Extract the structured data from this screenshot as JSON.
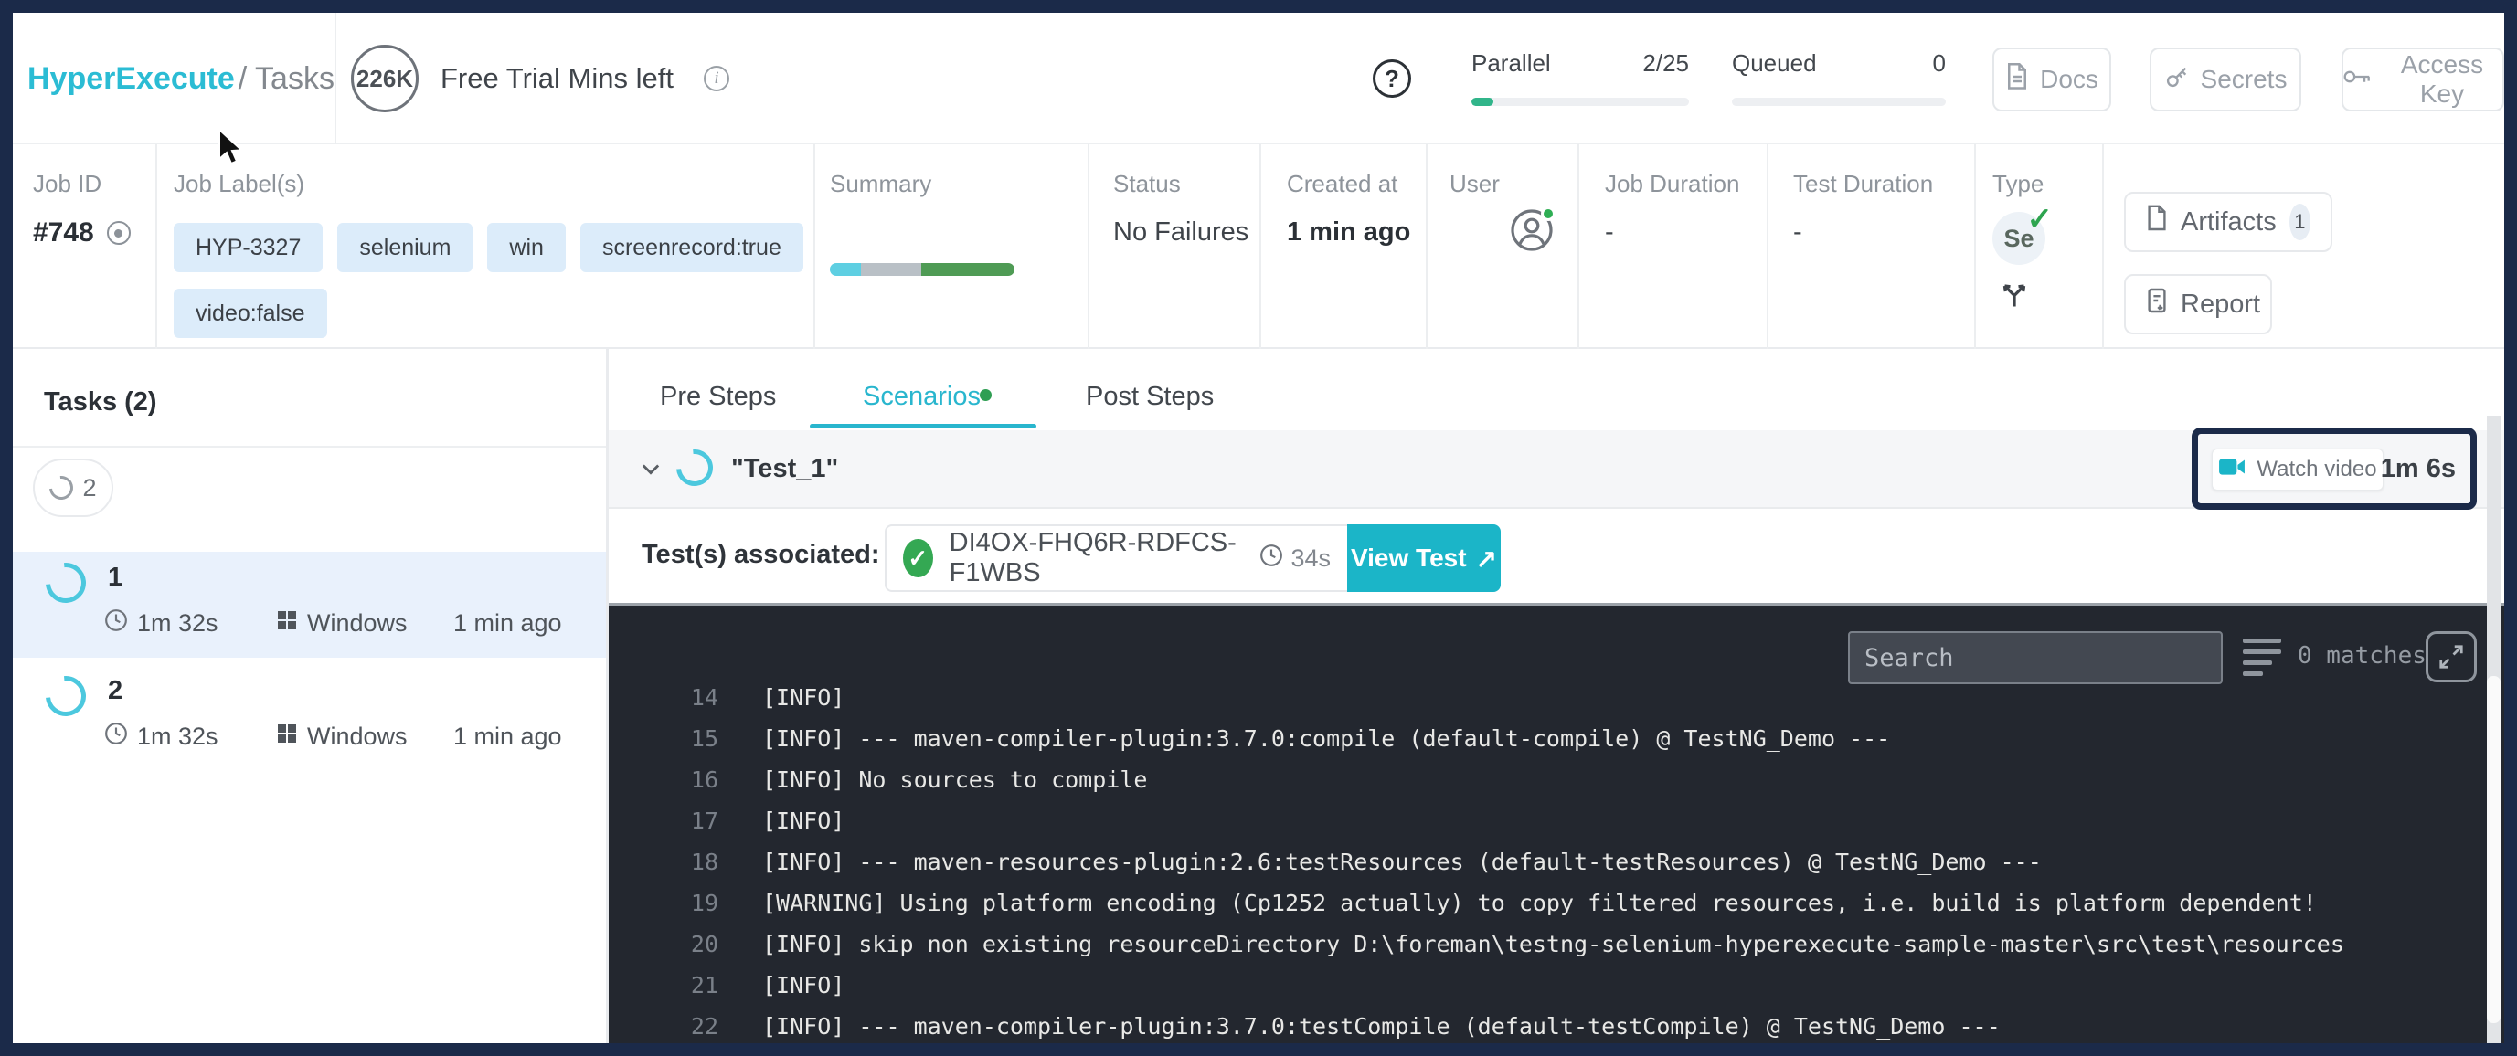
{
  "header": {
    "breadcrumb": {
      "brand": "HyperExecute",
      "rest": "/ Tasks"
    },
    "trial": {
      "badge": "226K",
      "label": "Free Trial Mins left"
    },
    "help": "?",
    "parallel": {
      "label": "Parallel",
      "value": "2/25"
    },
    "queued": {
      "label": "Queued",
      "value": "0"
    },
    "buttons": {
      "docs": "Docs",
      "secrets": "Secrets",
      "access_key": "Access Key"
    }
  },
  "job": {
    "job_id": {
      "label": "Job ID",
      "value": "#748"
    },
    "labels": {
      "label": "Job Label(s)",
      "chips": [
        "HYP-3327",
        "selenium",
        "win",
        "screenrecord:true",
        "video:false"
      ]
    },
    "summary": {
      "label": "Summary"
    },
    "status": {
      "label": "Status",
      "value": "No Failures"
    },
    "created": {
      "label": "Created at",
      "value": "1 min ago"
    },
    "user": {
      "label": "User"
    },
    "job_duration": {
      "label": "Job Duration",
      "value": "-"
    },
    "test_duration": {
      "label": "Test Duration",
      "value": "-"
    },
    "type": {
      "label": "Type",
      "badge": "Se",
      "check": "✓"
    },
    "artifacts": {
      "label": "Artifacts",
      "count": "1"
    },
    "report": {
      "label": "Report"
    }
  },
  "tasks": {
    "title": "Tasks (2)",
    "running_count": "2",
    "items": [
      {
        "id": "1",
        "duration": "1m 32s",
        "os": "Windows",
        "created": "1 min ago"
      },
      {
        "id": "2",
        "duration": "1m 32s",
        "os": "Windows",
        "created": "1 min ago"
      }
    ]
  },
  "panel": {
    "tabs": [
      {
        "label": "Pre Steps"
      },
      {
        "label": "Scenarios"
      },
      {
        "label": "Post Steps"
      }
    ],
    "scenario": {
      "name": "\"Test_1\"",
      "watch_video": "Watch video",
      "video_duration": "1m 6s"
    },
    "tests_associated": {
      "label": "Test(s) associated:",
      "check": "✓",
      "test_id": "DI4OX-FHQ6R-RDFCS-F1WBS",
      "duration": "34s",
      "view_test": "View Test",
      "arrow": "↗"
    }
  },
  "console": {
    "search_placeholder": "Search",
    "matches": "0 matches",
    "lines": [
      {
        "num": "14",
        "text": "[INFO]"
      },
      {
        "num": "15",
        "text": "[INFO] --- maven-compiler-plugin:3.7.0:compile (default-compile) @ TestNG_Demo ---"
      },
      {
        "num": "16",
        "text": "[INFO] No sources to compile"
      },
      {
        "num": "17",
        "text": "[INFO]"
      },
      {
        "num": "18",
        "text": "[INFO] --- maven-resources-plugin:2.6:testResources (default-testResources) @ TestNG_Demo ---"
      },
      {
        "num": "19",
        "text": "[WARNING] Using platform encoding (Cp1252 actually) to copy filtered resources, i.e. build is platform dependent!"
      },
      {
        "num": "20",
        "text": "[INFO] skip non existing resourceDirectory D:\\foreman\\testng-selenium-hyperexecute-sample-master\\src\\test\\resources"
      },
      {
        "num": "21",
        "text": "[INFO]"
      },
      {
        "num": "22",
        "text": "[INFO] --- maven-compiler-plugin:3.7.0:testCompile (default-testCompile) @ TestNG_Demo ---"
      }
    ]
  },
  "colors": {
    "frame_navy": "#1B2A49",
    "brand_teal": "#2BBCD4",
    "tab_active": "#29B6CE",
    "view_test_bg": "#1BB5C8",
    "success_green": "#34A853",
    "chip_blue": "#DCECFA",
    "selected_task_bg": "#E9F1FC",
    "scenario_row_bg": "#F5F6F8",
    "console_bg": "#23272F",
    "summary_segments": [
      "#5ECFE2",
      "#B9C0C6",
      "#4F9B55"
    ]
  }
}
